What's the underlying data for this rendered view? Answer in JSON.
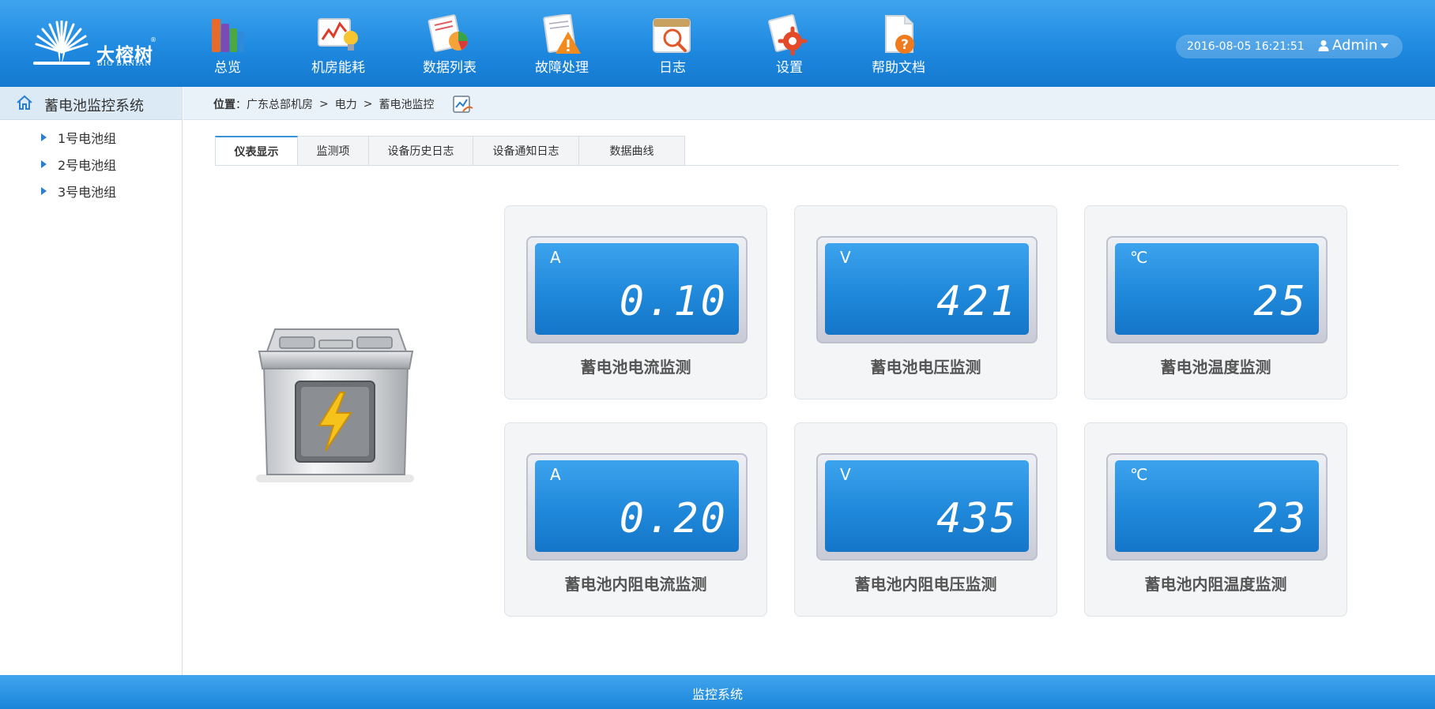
{
  "brand": {
    "name_cn": "大榕树",
    "name_en": "BIG BANIAN",
    "reg": "®"
  },
  "nav": [
    {
      "label": "总览",
      "icon": "books-icon"
    },
    {
      "label": "机房能耗",
      "icon": "energy-chart-bulb-icon"
    },
    {
      "label": "数据列表",
      "icon": "data-pie-chart-icon"
    },
    {
      "label": "故障处理",
      "icon": "warning-document-icon"
    },
    {
      "label": "日志",
      "icon": "calendar-search-icon"
    },
    {
      "label": "设置",
      "icon": "settings-gear-icon"
    },
    {
      "label": "帮助文档",
      "icon": "help-document-icon"
    }
  ],
  "header": {
    "datetime": "2016-08-05 16:21:51",
    "user": "Admin"
  },
  "sidebar": {
    "title": "蓄电池监控系统",
    "items": [
      {
        "label": "1号电池组"
      },
      {
        "label": "2号电池组"
      },
      {
        "label": "3号电池组"
      }
    ]
  },
  "breadcrumb": {
    "label": "位置",
    "colon": "：",
    "separator": ">",
    "items": [
      "广东总部机房",
      "电力",
      "蓄电池监控"
    ]
  },
  "tabs": [
    {
      "label": "仪表显示",
      "active": true
    },
    {
      "label": "监测项",
      "active": false
    },
    {
      "label": "设备历史日志",
      "active": false
    },
    {
      "label": "设备通知日志",
      "active": false
    },
    {
      "label": "数据曲线",
      "active": false
    }
  ],
  "gauges": [
    {
      "unit": "A",
      "value": "0.10",
      "label": "蓄电池电流监测"
    },
    {
      "unit": "V",
      "value": "421",
      "label": "蓄电池电压监测"
    },
    {
      "unit": "℃",
      "value": "25",
      "label": "蓄电池温度监测"
    },
    {
      "unit": "A",
      "value": "0.20",
      "label": "蓄电池内阻电流监测"
    },
    {
      "unit": "V",
      "value": "435",
      "label": "蓄电池内阻电压监测"
    },
    {
      "unit": "℃",
      "value": "23",
      "label": "蓄电池内阻温度监测"
    }
  ],
  "footer": {
    "text": "监控系统"
  },
  "colors": {
    "header_blue": "#2a8fe4",
    "lcd_blue": "#1e86d8",
    "sidebar_highlight": "#dceaf5"
  }
}
